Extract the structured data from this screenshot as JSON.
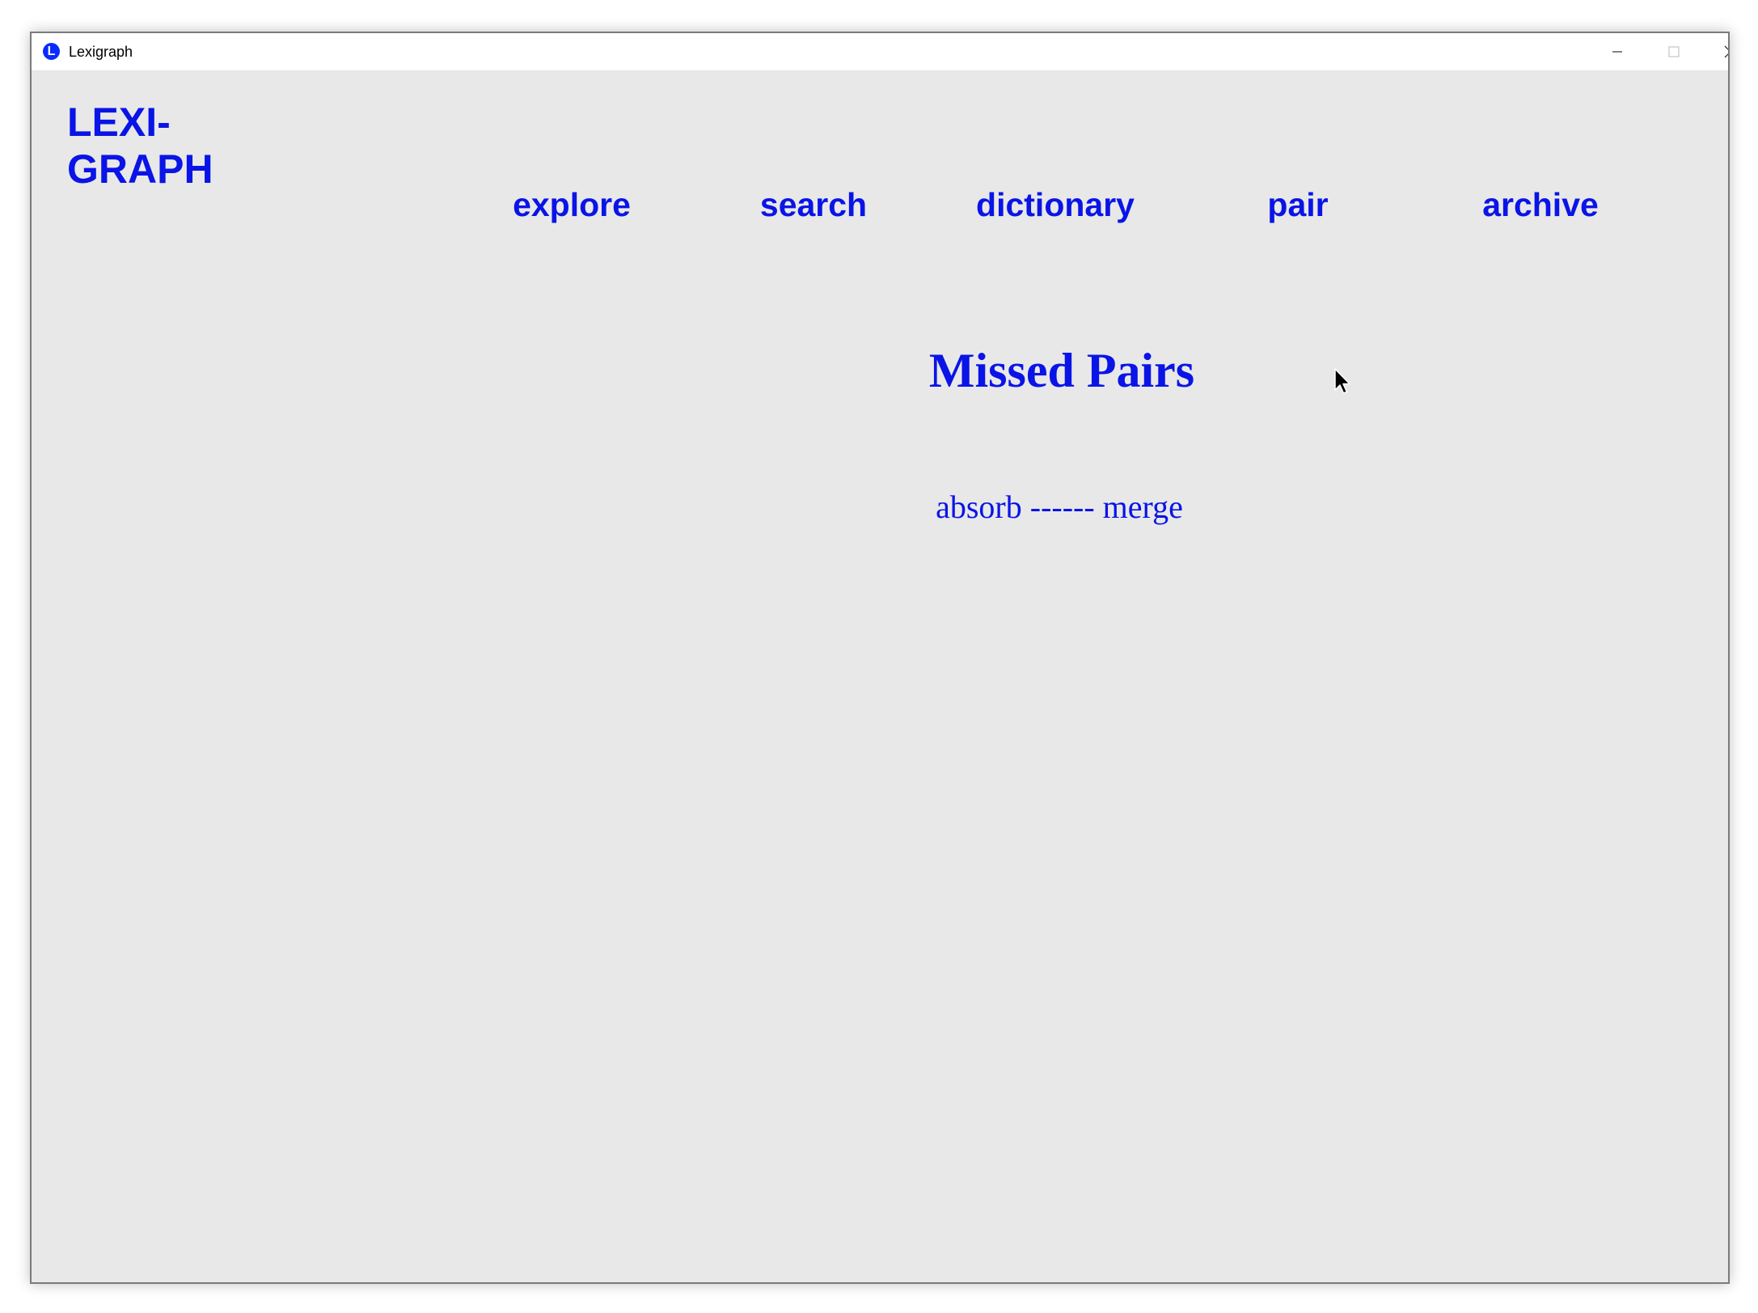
{
  "window": {
    "title": "Lexigraph",
    "icon_letter": "L",
    "controls": [
      "minimize-icon",
      "maximize-icon",
      "close-icon"
    ]
  },
  "header": {
    "logo_line1": "LEXI-",
    "logo_line2": "GRAPH",
    "nav": {
      "explore": "explore",
      "search": "search",
      "dictionary": "dictionary",
      "pair": "pair",
      "archive": "archive"
    }
  },
  "main": {
    "heading": "Missed Pairs",
    "pairs": [
      {
        "text": "absorb ------ merge"
      }
    ]
  },
  "colors": {
    "accent": "#0a14e6",
    "background": "#e8e8e8",
    "titlebar": "#ffffff"
  }
}
